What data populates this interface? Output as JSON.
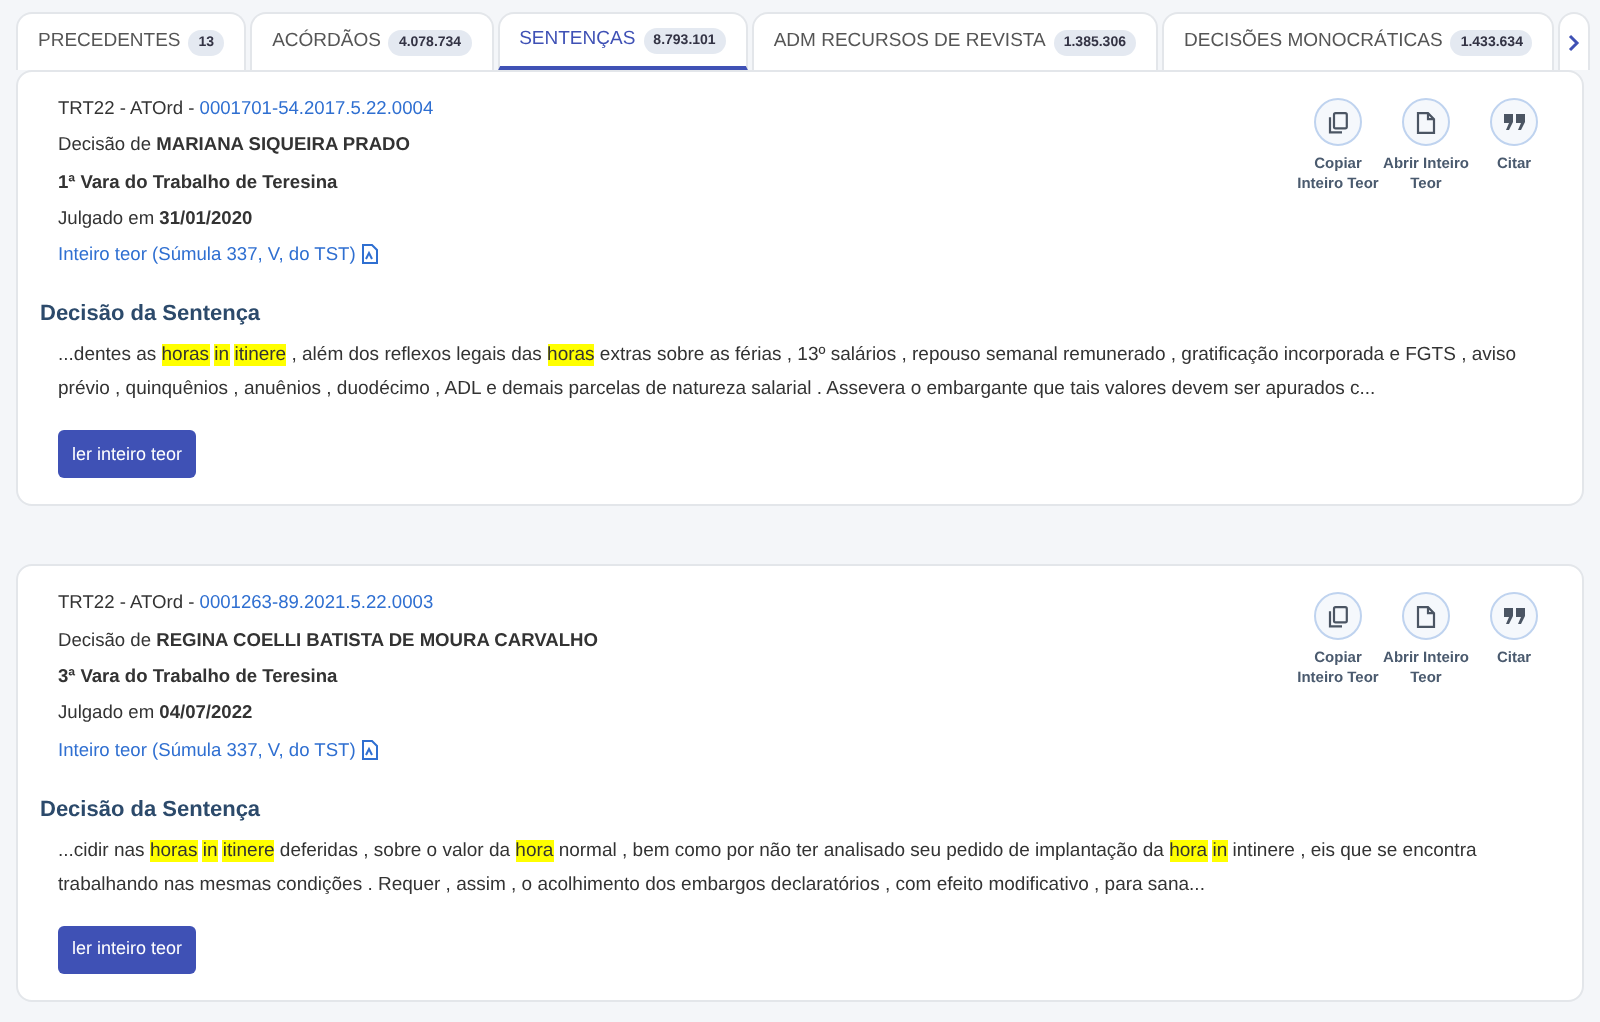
{
  "tabs": [
    {
      "label": "PRECEDENTES",
      "count": "13",
      "selected": false
    },
    {
      "label": "ACÓRDÃOS",
      "count": "4.078.734",
      "selected": false
    },
    {
      "label": "SENTENÇAS",
      "count": "8.793.101",
      "selected": true
    },
    {
      "label": "ADM RECURSOS DE REVISTA",
      "count": "1.385.306",
      "selected": false
    },
    {
      "label": "DECISÕES MONOCRÁTICAS",
      "count": "1.433.634",
      "selected": false
    }
  ],
  "results": [
    {
      "court": "TRT22 - ATOrd - ",
      "process": "0001701-54.2017.5.22.0004",
      "decision_prefix": "Decisão de ",
      "judge": "MARIANA SIQUEIRA PRADO",
      "court_unit": "1ª Vara do Trabalho de Teresina",
      "judged_prefix": "Julgado em ",
      "date": "31/01/2020",
      "full_text_link": "Inteiro teor (Súmula 337, V, do TST)",
      "actions": [
        {
          "kind": "copy",
          "label": "Copiar Inteiro Teor"
        },
        {
          "kind": "open",
          "label": "Abrir Inteiro Teor"
        },
        {
          "kind": "cite",
          "label": "Citar"
        }
      ],
      "section_title": "Decisão da Sentença",
      "excerpt": [
        {
          "text": "...dentes as ",
          "highlighted": false
        },
        {
          "text": "horas",
          "highlighted": true,
          "space_after": true
        },
        {
          "text": "in",
          "highlighted": true,
          "space_after": true
        },
        {
          "text": "itinere",
          "highlighted": true
        },
        {
          "text": " , além dos reflexos legais das ",
          "highlighted": false
        },
        {
          "text": "horas",
          "highlighted": true
        },
        {
          "text": " extras sobre as férias , 13º salários , repouso semanal remunerado , gratificação incorporada e FGTS , aviso prévio , quinquênios , anuênios , duodécimo , ADL e demais parcelas de natureza salarial . Assevera o embargante que tais valores devem ser apurados c...",
          "highlighted": false
        }
      ],
      "button": "ler inteiro teor"
    },
    {
      "court": "TRT22 - ATOrd - ",
      "process": "0001263-89.2021.5.22.0003",
      "decision_prefix": "Decisão de ",
      "judge": "REGINA COELLI BATISTA DE MOURA CARVALHO",
      "court_unit": "3ª Vara do Trabalho de Teresina",
      "judged_prefix": "Julgado em ",
      "date": "04/07/2022",
      "full_text_link": "Inteiro teor (Súmula 337, V, do TST)",
      "actions": [
        {
          "kind": "copy",
          "label": "Copiar Inteiro Teor"
        },
        {
          "kind": "open",
          "label": "Abrir Inteiro Teor"
        },
        {
          "kind": "cite",
          "label": "Citar"
        }
      ],
      "section_title": "Decisão da Sentença",
      "excerpt": [
        {
          "text": "...cidir nas ",
          "highlighted": false
        },
        {
          "text": "horas",
          "highlighted": true,
          "space_after": true
        },
        {
          "text": "in",
          "highlighted": true,
          "space_after": true
        },
        {
          "text": "itinere",
          "highlighted": true
        },
        {
          "text": " deferidas , sobre o valor da ",
          "highlighted": false
        },
        {
          "text": "hora",
          "highlighted": true
        },
        {
          "text": " normal , bem como por não ter analisado seu pedido de implantação da ",
          "highlighted": false
        },
        {
          "text": "hora",
          "highlighted": true,
          "space_after": true
        },
        {
          "text": "in",
          "highlighted": true
        },
        {
          "text": " intinere , eis que se encontra trabalhando nas mesmas condições . Requer , assim , o acolhimento dos embargos declaratórios , com efeito modificativo , para sana...",
          "highlighted": false
        }
      ],
      "button": "ler inteiro teor"
    }
  ]
}
